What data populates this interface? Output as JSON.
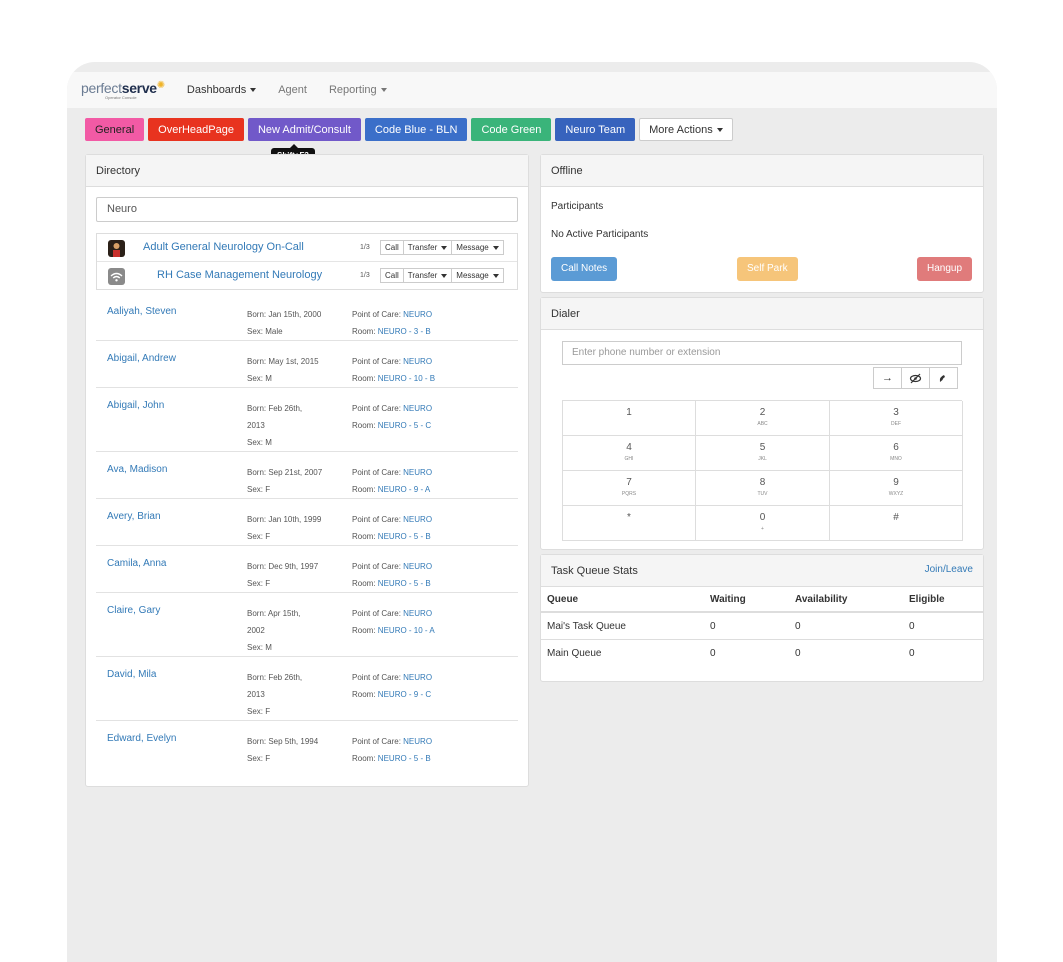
{
  "logo": {
    "part1": "perfect",
    "part2": "serve",
    "subtitle": "Operator Console"
  },
  "nav": {
    "dashboards": "Dashboards",
    "agent": "Agent",
    "reporting": "Reporting"
  },
  "actions": {
    "general": "General",
    "overhead": "OverHeadPage",
    "new_admit": "New Admit/Consult",
    "code_blue": "Code Blue - BLN",
    "code_green": "Code Green",
    "neuro_team": "Neuro Team",
    "more": "More Actions"
  },
  "tooltip": "Shift+F3",
  "directory": {
    "title": "Directory",
    "search_value": "Neuro",
    "pager": "1/3",
    "teams": [
      {
        "name": "Adult General Neurology On-Call",
        "call": "Call",
        "transfer": "Transfer",
        "message": "Message"
      },
      {
        "name": "RH Case Management Neurology",
        "call": "Call",
        "transfer": "Transfer",
        "message": "Message"
      }
    ],
    "people": [
      {
        "name": "Aaliyah, Steven",
        "born_1": "Born: Jan 15th, 2000",
        "born_2": "",
        "sex": "Sex: Male",
        "poc_label": "Point of Care:",
        "poc": "NEURO",
        "room_label": "Room:",
        "room": "NEURO - 3 - B"
      },
      {
        "name": "Abigail, Andrew",
        "born_1": "Born: May 1st, 2015",
        "born_2": "",
        "sex": "Sex: M",
        "poc_label": "Point of Care:",
        "poc": "NEURO",
        "room_label": "Room:",
        "room": "NEURO - 10 - B"
      },
      {
        "name": "Abigail, John",
        "born_1": "Born: Feb 26th,",
        "born_2": "2013",
        "sex": "Sex: M",
        "poc_label": "Point of Care:",
        "poc": "NEURO",
        "room_label": "Room:",
        "room": "NEURO - 5 - C"
      },
      {
        "name": "Ava, Madison",
        "born_1": "Born: Sep 21st, 2007",
        "born_2": "",
        "sex": "Sex: F",
        "poc_label": "Point of Care:",
        "poc": "NEURO",
        "room_label": "Room:",
        "room": "NEURO - 9 - A"
      },
      {
        "name": "Avery, Brian",
        "born_1": "Born: Jan 10th, 1999",
        "born_2": "",
        "sex": "Sex: F",
        "poc_label": "Point of Care:",
        "poc": "NEURO",
        "room_label": "Room:",
        "room": "NEURO - 5 - B"
      },
      {
        "name": "Camila, Anna",
        "born_1": "Born: Dec 9th, 1997",
        "born_2": "",
        "sex": "Sex: F",
        "poc_label": "Point of Care:",
        "poc": "NEURO",
        "room_label": "Room:",
        "room": "NEURO - 5 - B"
      },
      {
        "name": "Claire, Gary",
        "born_1": "Born: Apr 15th,",
        "born_2": "2002",
        "sex": "Sex: M",
        "poc_label": "Point of Care:",
        "poc": "NEURO",
        "room_label": "Room:",
        "room": "NEURO - 10 - A"
      },
      {
        "name": "David, Mila",
        "born_1": "Born: Feb 26th,",
        "born_2": "2013",
        "sex": "Sex: F",
        "poc_label": "Point of Care:",
        "poc": "NEURO",
        "room_label": "Room:",
        "room": "NEURO - 9 - C"
      },
      {
        "name": "Edward, Evelyn",
        "born_1": "Born: Sep 5th, 1994",
        "born_2": "",
        "sex": "Sex: F",
        "poc_label": "Point of Care:",
        "poc": "NEURO",
        "room_label": "Room:",
        "room": "NEURO - 5 - B"
      }
    ]
  },
  "offline": {
    "title": "Offline",
    "participants_label": "Participants",
    "no_active": "No Active Participants",
    "call_notes": "Call Notes",
    "self_park": "Self Park",
    "hangup": "Hangup"
  },
  "dialer": {
    "title": "Dialer",
    "placeholder": "Enter phone number or extension",
    "keys": [
      {
        "digit": "1",
        "letters": ""
      },
      {
        "digit": "2",
        "letters": "ABC"
      },
      {
        "digit": "3",
        "letters": "DEF"
      },
      {
        "digit": "4",
        "letters": "GHI"
      },
      {
        "digit": "5",
        "letters": "JKL"
      },
      {
        "digit": "6",
        "letters": "MNO"
      },
      {
        "digit": "7",
        "letters": "PQRS"
      },
      {
        "digit": "8",
        "letters": "TUV"
      },
      {
        "digit": "9",
        "letters": "WXYZ"
      },
      {
        "digit": "*",
        "letters": ""
      },
      {
        "digit": "0",
        "letters": "+"
      },
      {
        "digit": "#",
        "letters": ""
      }
    ]
  },
  "task_queue": {
    "title": "Task Queue Stats",
    "join_leave": "Join/Leave",
    "columns": [
      "Queue",
      "Waiting",
      "Availability",
      "Eligible"
    ],
    "rows": [
      [
        "Mai's Task Queue",
        "0",
        "0",
        "0"
      ],
      [
        "Main Queue",
        "0",
        "0",
        "0"
      ]
    ]
  },
  "colors": {
    "general": "#f25aa5",
    "overhead": "#e8331f",
    "new_admit": "#7159c9",
    "code_blue": "#3b6fc9",
    "code_green": "#3ab47a",
    "neuro_team": "#3763bd",
    "call_notes": "#5b9bd5",
    "self_park": "#f6c57a",
    "hangup": "#e07b7b",
    "link": "#337ab7"
  }
}
